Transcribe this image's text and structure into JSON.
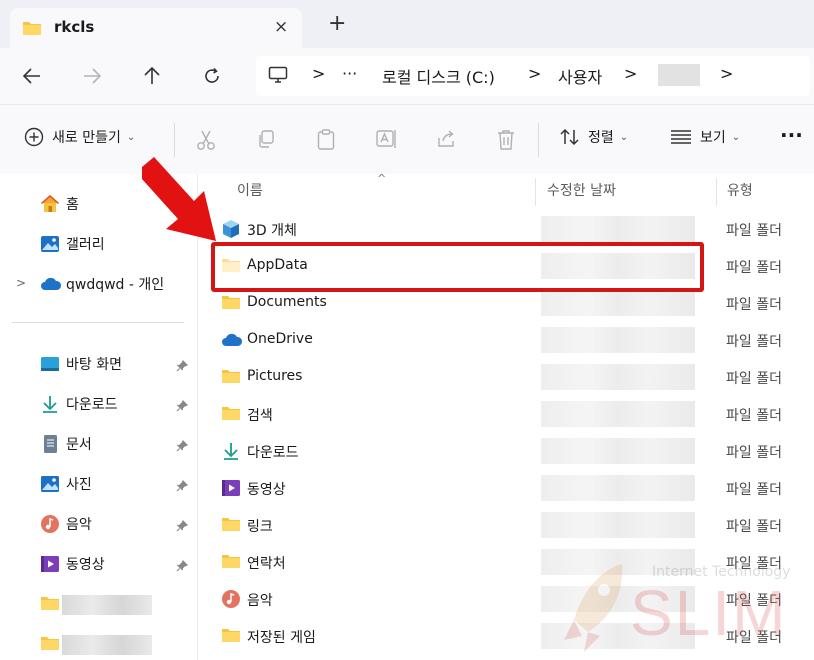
{
  "window": {
    "tab_title": "rkcls",
    "close_symbol": "×",
    "new_tab_symbol": "+"
  },
  "nav": {
    "address": {
      "separator": ">",
      "ellipsis": "···",
      "crumbs": [
        "로컬 디스크 (C:)",
        "사용자"
      ],
      "trailing_separator": ">"
    }
  },
  "toolbar": {
    "new_label": "새로 만들기",
    "sort_label": "정렬",
    "view_label": "보기",
    "more_symbol": "···",
    "caret": "⌄"
  },
  "sidebar": {
    "expand_symbol": ">",
    "items": [
      {
        "label": "홈",
        "icon": "home-icon"
      },
      {
        "label": "갤러리",
        "icon": "gallery-icon"
      },
      {
        "label": "qwdqwd - 개인",
        "icon": "onedrive-cloud-icon"
      }
    ],
    "pinned": [
      {
        "label": "바탕 화면",
        "icon": "desktop-icon"
      },
      {
        "label": "다운로드",
        "icon": "download-icon"
      },
      {
        "label": "문서",
        "icon": "document-icon"
      },
      {
        "label": "사진",
        "icon": "pictures-icon"
      },
      {
        "label": "음악",
        "icon": "music-icon"
      },
      {
        "label": "동영상",
        "icon": "video-icon"
      }
    ]
  },
  "columns": {
    "name": "이름",
    "modified": "수정한 날짜",
    "type": "유형",
    "sort_caret": "^"
  },
  "files": [
    {
      "name": "3D 개체",
      "type": "파일 폴더",
      "icon": "3d-objects-icon"
    },
    {
      "name": "AppData",
      "type": "파일 폴더",
      "icon": "folder-icon-hidden"
    },
    {
      "name": "Documents",
      "type": "파일 폴더",
      "icon": "folder-icon"
    },
    {
      "name": "OneDrive",
      "type": "파일 폴더",
      "icon": "onedrive-cloud-icon"
    },
    {
      "name": "Pictures",
      "type": "파일 폴더",
      "icon": "folder-icon"
    },
    {
      "name": "검색",
      "type": "파일 폴더",
      "icon": "folder-icon"
    },
    {
      "name": "다운로드",
      "type": "파일 폴더",
      "icon": "download-icon"
    },
    {
      "name": "동영상",
      "type": "파일 폴더",
      "icon": "video-icon"
    },
    {
      "name": "링크",
      "type": "파일 폴더",
      "icon": "folder-icon"
    },
    {
      "name": "연락처",
      "type": "파일 폴더",
      "icon": "folder-icon"
    },
    {
      "name": "음악",
      "type": "파일 폴더",
      "icon": "music-icon"
    },
    {
      "name": "저장된 게임",
      "type": "파일 폴더",
      "icon": "folder-icon"
    }
  ],
  "watermark": {
    "top": "Internet Technology",
    "main": "SLIM"
  },
  "colors": {
    "annotation_red": "#d51414",
    "folder_yellow": "#f5c542",
    "accent_blue": "#1a73c8"
  }
}
